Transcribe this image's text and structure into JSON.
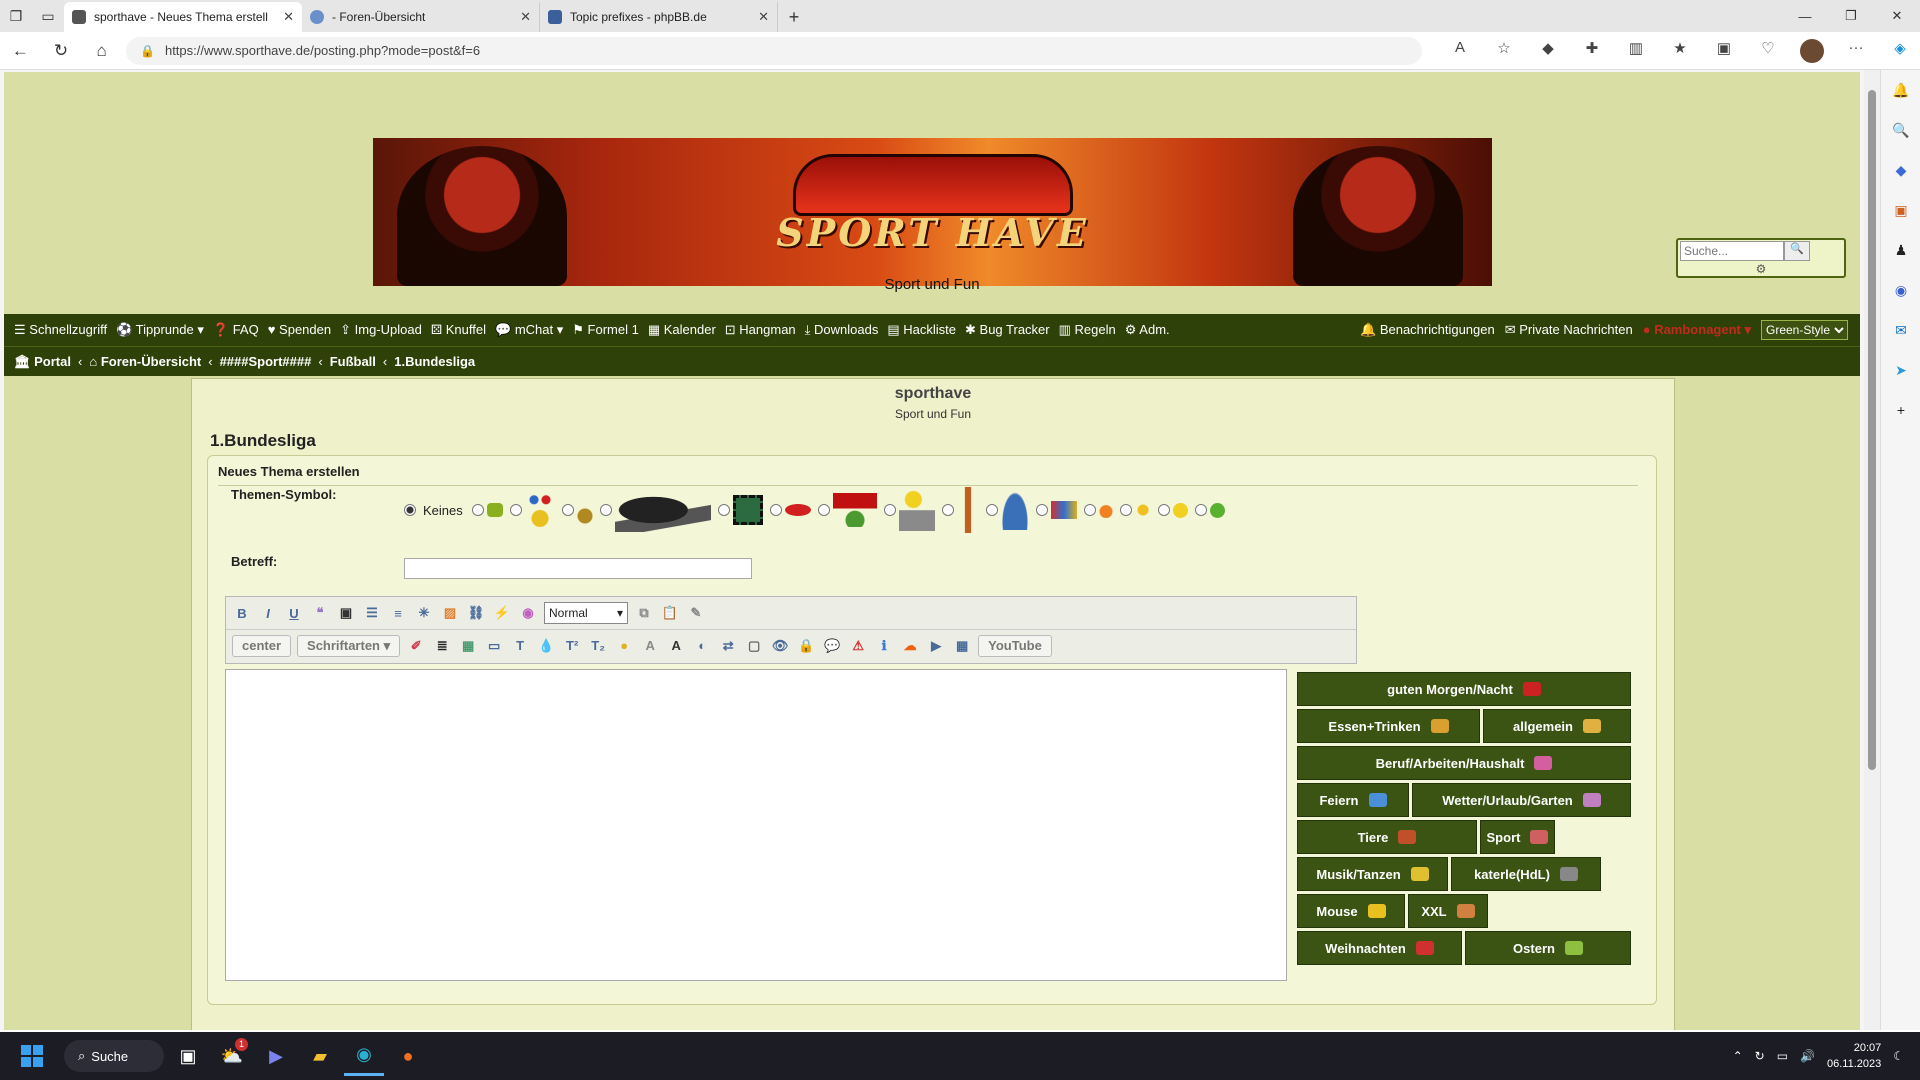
{
  "browser": {
    "tabs": [
      {
        "title": "sporthave - Neues Thema erstell",
        "active": true
      },
      {
        "title": "- Foren-Übersicht",
        "active": false
      },
      {
        "title": "Topic prefixes - phpBB.de",
        "active": false
      }
    ],
    "url": "https://www.sporthave.de/posting.php?mode=post&f=6"
  },
  "site": {
    "tagline": "Sport und Fun",
    "banner_text": "SPORT HAVE",
    "search_placeholder": "Suche...",
    "nav_items": [
      {
        "icon": "menu-icon",
        "glyph": "☰",
        "label": "Schnellzugriff"
      },
      {
        "icon": "tippfigure-icon",
        "glyph": "⚽",
        "label": "Tipprunde ▾"
      },
      {
        "icon": "question-icon",
        "glyph": "❓",
        "label": "FAQ"
      },
      {
        "icon": "heart-icon",
        "glyph": "♥",
        "label": "Spenden"
      },
      {
        "icon": "upload-icon",
        "glyph": "⇪",
        "label": "Img-Upload"
      },
      {
        "icon": "dice-icon",
        "glyph": "⚄",
        "label": "Knuffel"
      },
      {
        "icon": "chat-icon",
        "glyph": "💬",
        "label": "mChat ▾"
      },
      {
        "icon": "flag-icon",
        "glyph": "⚑",
        "label": "Formel 1"
      },
      {
        "icon": "calendar-icon",
        "glyph": "▦",
        "label": "Kalender"
      },
      {
        "icon": "hangman-icon",
        "glyph": "⊡",
        "label": "Hangman"
      },
      {
        "icon": "download-icon",
        "glyph": "⤓",
        "label": "Downloads"
      },
      {
        "icon": "map-icon",
        "glyph": "▤",
        "label": "Hackliste"
      },
      {
        "icon": "bug-icon",
        "glyph": "✱",
        "label": "Bug Tracker"
      },
      {
        "icon": "book-icon",
        "glyph": "▥",
        "label": "Regeln"
      },
      {
        "icon": "gears-icon",
        "glyph": "⚙",
        "label": "Adm."
      }
    ],
    "notifications_label": "Benachrichtigungen",
    "pm_label": "Private Nachrichten",
    "username": "Rambonagent",
    "style_select": "Green-Style",
    "breadcrumbs": [
      "Portal",
      "Foren-Übersicht",
      "####Sport####",
      "Fußball",
      "1.Bundesliga"
    ],
    "site_name": "sporthave",
    "site_desc": "Sport und Fun"
  },
  "post": {
    "forum_title": "1.Bundesliga",
    "form_title": "Neues Thema erstellen",
    "icon_label": "Themen-Symbol:",
    "none_label": "Keines",
    "subject_label": "Betreff:",
    "subject_value": "",
    "font_size_select": "Normal",
    "center_btn": "center",
    "fonts_btn": "Schriftarten ▾",
    "youtube_btn": "YouTube",
    "message_value": ""
  },
  "smilie_groups": [
    {
      "label": "guten Morgen/Nacht",
      "color": "#c22"
    },
    {
      "label": "Essen+Trinken",
      "color": "#d9a030"
    },
    {
      "label": "allgemein",
      "color": "#e0b040"
    },
    {
      "label": "Beruf/Arbeiten/Haushalt",
      "color": "#d35fa0"
    },
    {
      "label": "Feiern",
      "color": "#4a8fd8"
    },
    {
      "label": "Wetter/Urlaub/Garten",
      "color": "#c080c0"
    },
    {
      "label": "Tiere",
      "color": "#c0502a"
    },
    {
      "label": "Sport",
      "color": "#d06060"
    },
    {
      "label": "Musik/Tanzen",
      "color": "#e0c030"
    },
    {
      "label": "katerle(HdL)",
      "color": "#888888"
    },
    {
      "label": "Mouse",
      "color": "#e8c020"
    },
    {
      "label": "XXL",
      "color": "#d08040"
    },
    {
      "label": "Weihnachten",
      "color": "#d03030"
    },
    {
      "label": "Ostern",
      "color": "#8fbf40"
    }
  ],
  "taskbar": {
    "search_label": "Suche",
    "time": "20:07",
    "date": "06.11.2023",
    "weather_badge": "1"
  }
}
